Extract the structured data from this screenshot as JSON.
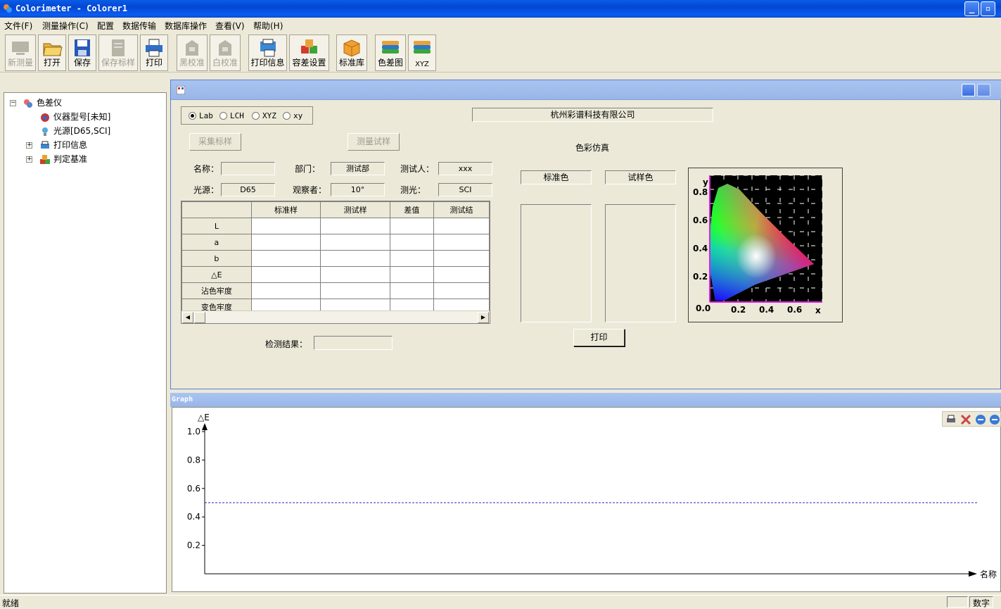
{
  "window": {
    "title": "Colorimeter - Colorer1"
  },
  "menu": [
    "文件(F)",
    "测量操作(C)",
    "配置",
    "数据传输",
    "数据库操作",
    "查看(V)",
    "帮助(H)"
  ],
  "toolbar": {
    "new": "新测量",
    "open": "打开",
    "save": "保存",
    "save_std": "保存标样",
    "print": "打印",
    "black_cal": "黑校准",
    "white_cal": "白校准",
    "print_info": "打印信息",
    "tolerance": "容差设置",
    "std_lib": "标准库",
    "diff_chart": "色差图",
    "xyz": "XYZ"
  },
  "tree": {
    "root": "色差仪",
    "model": "仪器型号[未知]",
    "light": "光源[D65,SCI]",
    "print_info": "打印信息",
    "criteria": "判定基准"
  },
  "form": {
    "radios": [
      "Lab",
      "LCH",
      "XYZ",
      "xy"
    ],
    "selected": "Lab",
    "company": "杭州彩谱科技有限公司",
    "collect_std": "采集标样",
    "measure_trial": "测量试样",
    "color_sim": "色彩仿真",
    "name_label": "名称：",
    "name_value": "",
    "dept_label": "部门：",
    "dept_value": "测试部",
    "tester_label": "测试人：",
    "tester_value": "xxx",
    "light_label": "光源：",
    "light_value": "D65",
    "observer_label": "观察者：",
    "observer_value": "10°",
    "measure_label": "测光：",
    "measure_value": "SCI",
    "std_color": "标准色",
    "trial_color": "试样色",
    "print_btn": "打印",
    "result_label": "检测结果：",
    "result_value": ""
  },
  "table": {
    "headers": [
      "",
      "标准样",
      "测试样",
      "差值",
      "测试结"
    ],
    "rows": [
      "L",
      "a",
      "b",
      "△E",
      "沾色牢度",
      "变色牢度"
    ]
  },
  "cie": {
    "y_label": "y",
    "x_label": "x",
    "y_ticks": [
      "0.8",
      "0.6",
      "0.4",
      "0.2",
      "0.0"
    ],
    "x_ticks": [
      "0.2",
      "0.4",
      "0.6"
    ]
  },
  "graph": {
    "title": "Graph",
    "y_label": "△E",
    "x_label": "名称",
    "chart_data": {
      "type": "line",
      "ylabel": "△E",
      "xlabel": "名称",
      "y_ticks": [
        0.2,
        0.4,
        0.6,
        0.8,
        1.0
      ],
      "ylim": [
        0,
        1.0
      ],
      "threshold": 0.5,
      "series": []
    }
  },
  "status": {
    "left": "就绪",
    "right": "数字"
  },
  "colors": {
    "titlebar": "#0347d3",
    "mdi_caption": "#98b6e9",
    "face": "#ece9d8"
  }
}
